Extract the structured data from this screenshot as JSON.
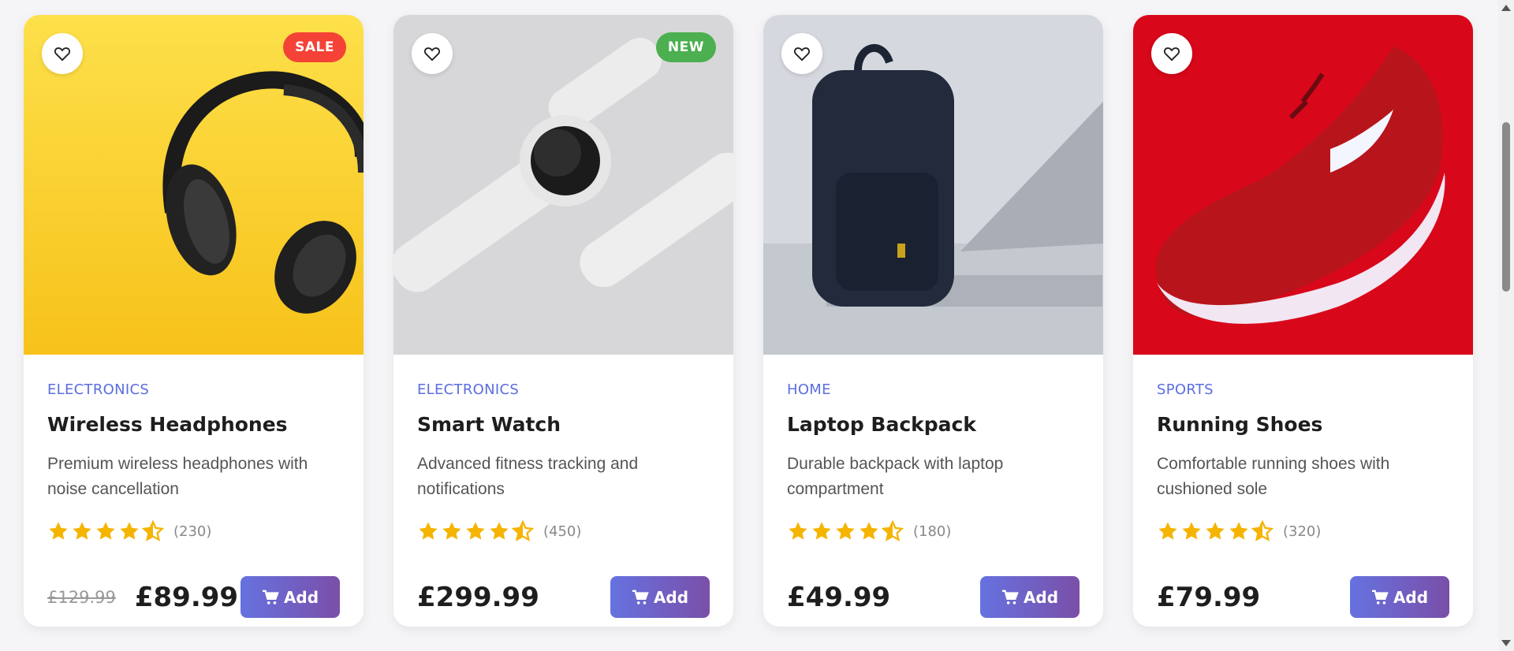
{
  "colors": {
    "accent": "#5b6ee1",
    "star": "#f5b400",
    "sale": "#f44336",
    "new": "#4caf50",
    "button_start": "#6672e0",
    "button_end": "#7a4fa8"
  },
  "products": [
    {
      "badge": "SALE",
      "badge_color": "#f44336",
      "image": "headphones",
      "category": "Electronics",
      "name": "Wireless Headphones",
      "description": "Premium wireless headphones with noise cancellation",
      "rating": 4.5,
      "reviews": "(230)",
      "old_price": "£129.99",
      "price": "£89.99",
      "add_label": "Add",
      "add_icon": "cart-icon",
      "fav_icon": "heart-icon"
    },
    {
      "badge": "NEW",
      "badge_color": "#4caf50",
      "image": "smart-watch",
      "category": "Electronics",
      "name": "Smart Watch",
      "description": "Advanced fitness tracking and notifications",
      "rating": 4.5,
      "reviews": "(450)",
      "old_price": "",
      "price": "£299.99",
      "add_label": "Add",
      "add_icon": "cart-icon",
      "fav_icon": "heart-icon"
    },
    {
      "badge": "",
      "badge_color": "",
      "image": "backpack",
      "category": "Home",
      "name": "Laptop Backpack",
      "description": "Durable backpack with laptop compartment",
      "rating": 4.5,
      "reviews": "(180)",
      "old_price": "",
      "price": "£49.99",
      "add_label": "Add",
      "add_icon": "cart-icon",
      "fav_icon": "heart-icon"
    },
    {
      "badge": "",
      "badge_color": "",
      "image": "running-shoe",
      "category": "Sports",
      "name": "Running Shoes",
      "description": "Comfortable running shoes with cushioned sole",
      "rating": 4.5,
      "reviews": "(320)",
      "old_price": "",
      "price": "£79.99",
      "add_label": "Add",
      "add_icon": "cart-icon",
      "fav_icon": "heart-icon"
    }
  ]
}
